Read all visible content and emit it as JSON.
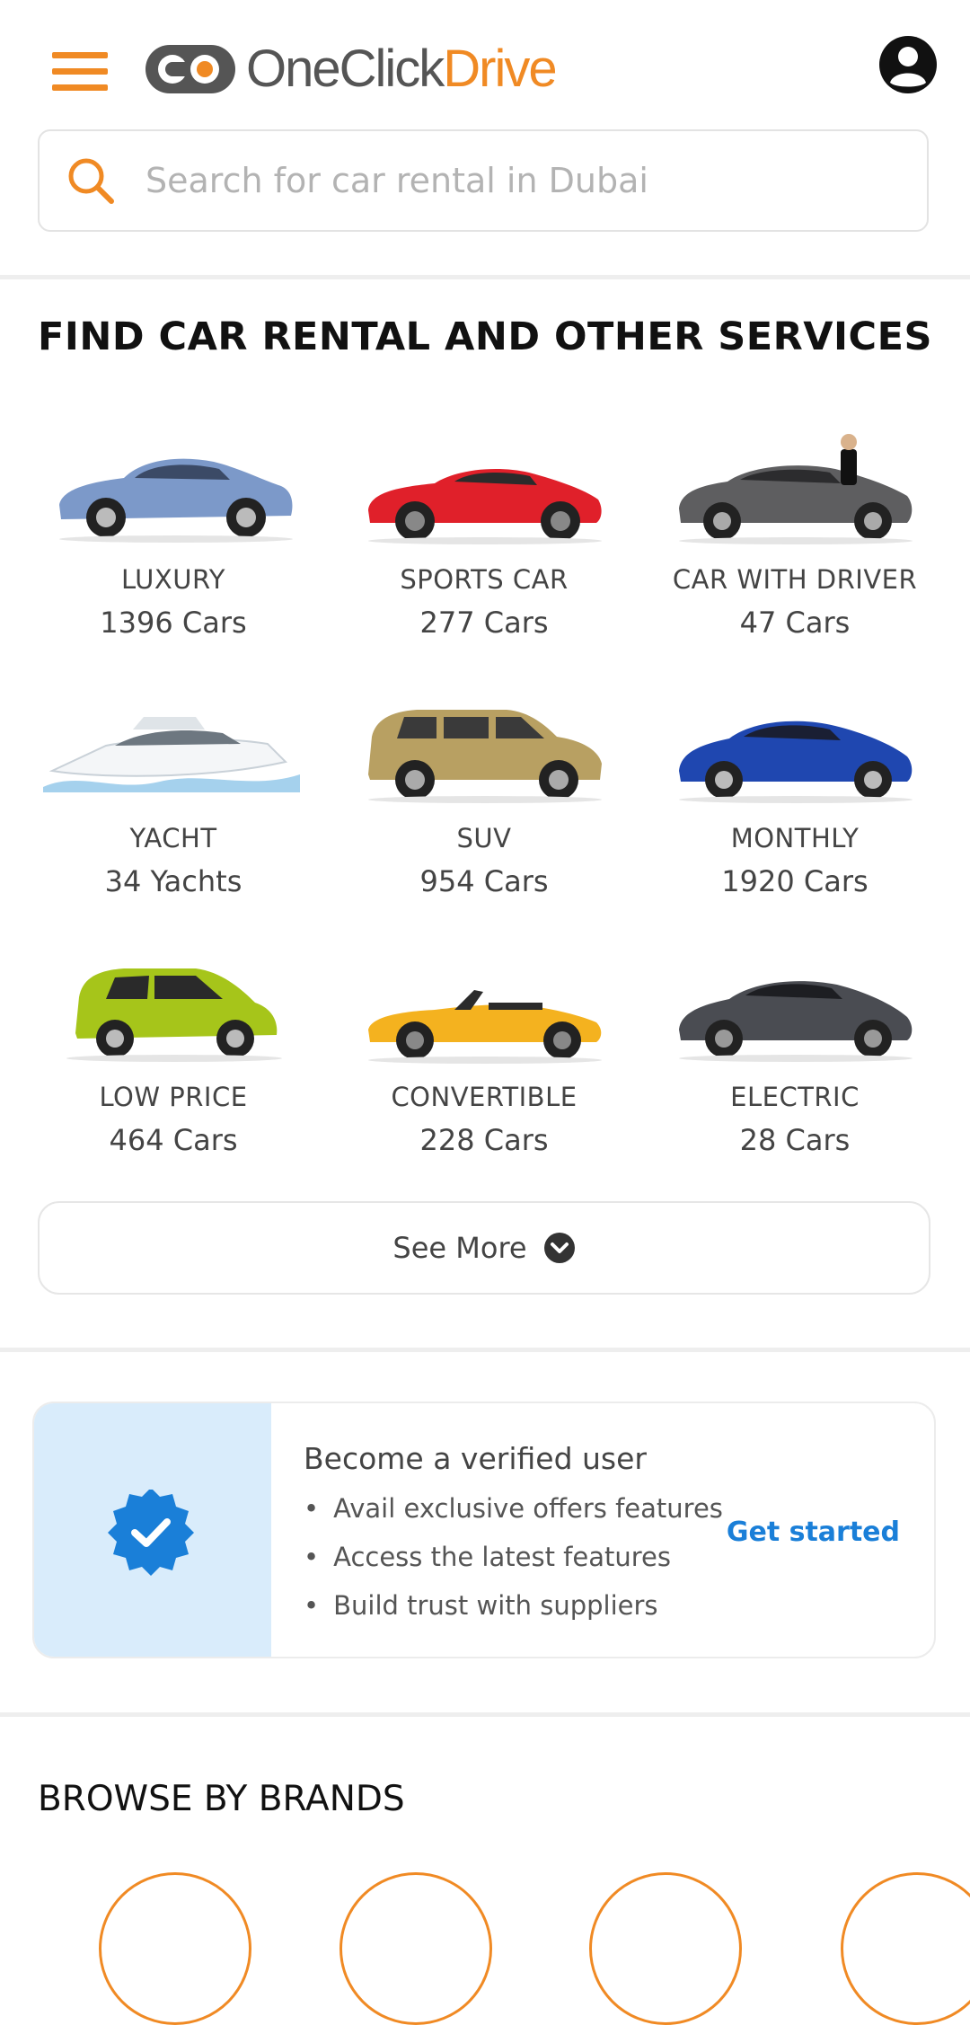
{
  "header": {
    "logo_one_click": "OneClick",
    "logo_drive": "Drive"
  },
  "search": {
    "placeholder": "Search for car rental in Dubai"
  },
  "services": {
    "title": "FIND CAR RENTAL AND OTHER SERVICES",
    "items": [
      {
        "label": "LUXURY",
        "count": "1396 Cars",
        "icon": "luxury-car-icon",
        "color": "#7c99c9"
      },
      {
        "label": "SPORTS CAR",
        "count": "277 Cars",
        "icon": "sports-car-icon",
        "color": "#e0202a"
      },
      {
        "label": "CAR WITH DRIVER",
        "count": "47 Cars",
        "icon": "car-with-driver-icon",
        "color": "#5e5e60"
      },
      {
        "label": "YACHT",
        "count": "34 Yachts",
        "icon": "yacht-icon",
        "color": "#e8ecef"
      },
      {
        "label": "SUV",
        "count": "954 Cars",
        "icon": "suv-icon",
        "color": "#b8a062"
      },
      {
        "label": "MONTHLY",
        "count": "1920 Cars",
        "icon": "monthly-car-icon",
        "color": "#1f47b0"
      },
      {
        "label": "LOW PRICE",
        "count": "464 Cars",
        "icon": "low-price-car-icon",
        "color": "#a6c51a"
      },
      {
        "label": "CONVERTIBLE",
        "count": "228 Cars",
        "icon": "convertible-car-icon",
        "color": "#f4b21f"
      },
      {
        "label": "ELECTRIC",
        "count": "28 Cars",
        "icon": "electric-car-icon",
        "color": "#4a4c52"
      }
    ],
    "see_more": "See More"
  },
  "verify": {
    "title": "Become a verified user",
    "bullets": [
      "Avail exclusive offers features",
      "Access the latest features",
      "Build trust with suppliers"
    ],
    "cta": "Get started",
    "accent": "#1a7fd8"
  },
  "brands": {
    "title": "BROWSE BY BRANDS"
  },
  "colors": {
    "brand_orange": "#f08a24",
    "link_blue": "#1a7fd8"
  }
}
